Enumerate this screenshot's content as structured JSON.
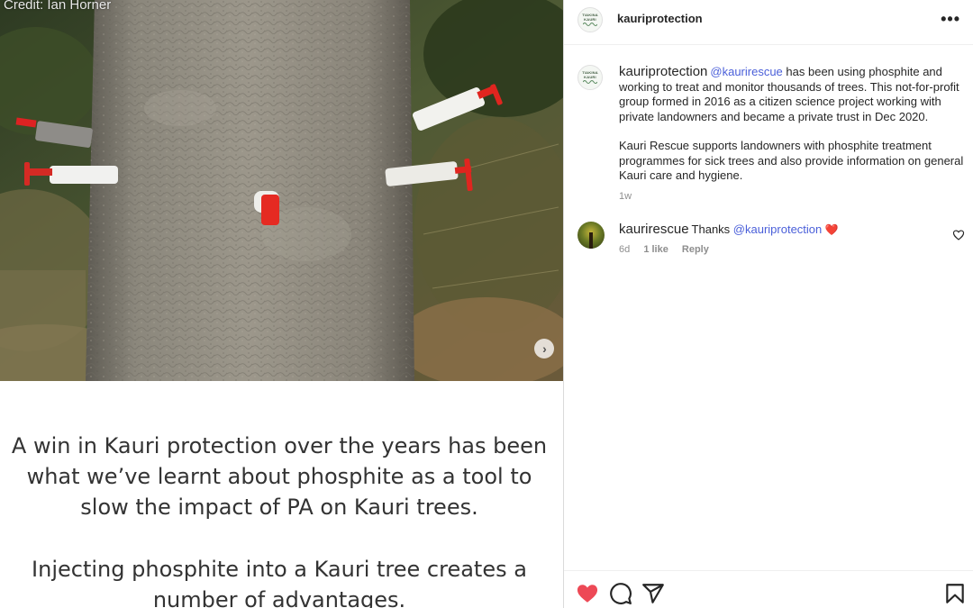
{
  "media": {
    "credit": "Credit: Ian Horner",
    "next_icon": "chevron-right-icon",
    "slide_text_1": "A win in Kauri protection over the years has been what we’ve learnt about phosphite as a tool to slow the impact of PA on Kauri trees.",
    "slide_text_2": "Injecting phosphite into a Kauri tree creates a number of advantages."
  },
  "header": {
    "username": "kauriprotection",
    "logo_text_1": "TIAKINA",
    "logo_text_2": "KAURI",
    "more_icon": "more-horizontal-icon"
  },
  "caption": {
    "username": "kauriprotection",
    "mention": "@kaurirescue",
    "text1": " has been using phosphite and working to treat and monitor thousands of trees. This not-for-profit group formed in 2016 as a citizen science project working with private landowners and became a private trust in Dec 2020.",
    "text2": "Kauri Rescue supports landowners with phosphite treatment programmes for sick trees and also provide information on general Kauri care and hygiene.",
    "time": "1w"
  },
  "comments": [
    {
      "username": "kaurirescue",
      "text": "Thanks ",
      "mention": "@kauriprotection",
      "emoji": "❤️",
      "time": "6d",
      "likes": "1 like",
      "reply": "Reply"
    }
  ],
  "actions": {
    "like_icon": "heart-filled-icon",
    "comment_icon": "comment-icon",
    "share_icon": "share-icon",
    "save_icon": "bookmark-icon",
    "like_color": "#ed4956"
  }
}
